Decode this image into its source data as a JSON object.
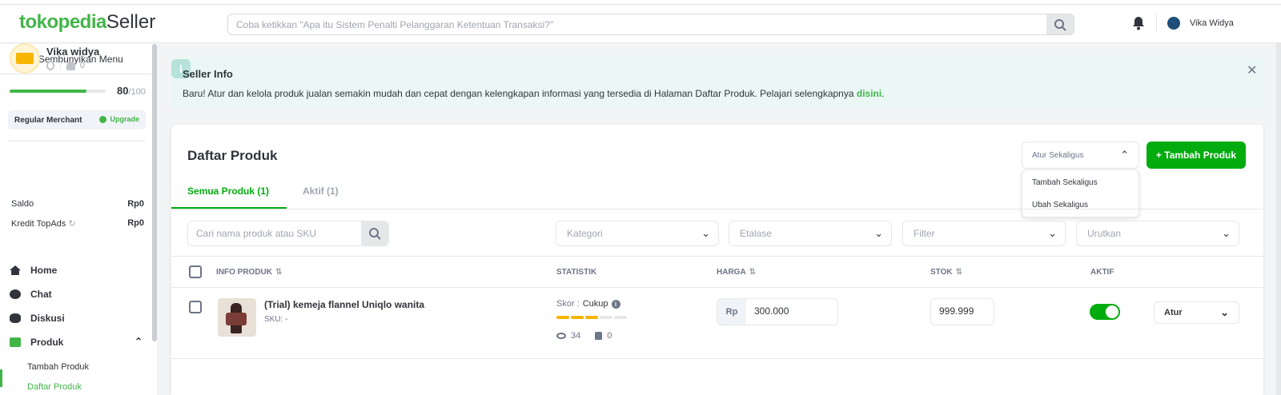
{
  "header": {
    "logo_main": "tokopedia",
    "logo_sub": "Seller",
    "search_placeholder": "Coba ketikkan \"Apa itu Sistem Penalti Pelanggaran Ketentuan Transaksi?\"",
    "user_name": "Vika Widya"
  },
  "sidebar": {
    "hide_menu": "Sembunyikan Menu",
    "shop_name": "Vika widya",
    "followers": "0",
    "score": "80",
    "score_max": "/100",
    "score_fraction": 0.8,
    "merchant_type": "Regular Merchant",
    "upgrade": "Upgrade",
    "saldo_label": "Saldo",
    "saldo_value": "Rp0",
    "kredit_label": "Kredit TopAds",
    "kredit_value": "Rp0",
    "nav": {
      "home": "Home",
      "chat": "Chat",
      "diskusi": "Diskusi",
      "produk": "Produk",
      "tambah_produk": "Tambah Produk",
      "daftar_produk": "Daftar Produk"
    }
  },
  "banner": {
    "title": "Seller Info",
    "text": "Baru! Atur dan kelola produk jualan semakin mudah dan cepat dengan kelengkapan informasi yang tersedia di Halaman Daftar Produk. Pelajari selengkapnya ",
    "link": "disini",
    "suffix": "."
  },
  "main": {
    "title": "Daftar Produk",
    "bulk_label": "Atur Sekaligus",
    "bulk_options": [
      "Tambah Sekaligus",
      "Ubah Sekaligus"
    ],
    "add_button": "+ Tambah Produk",
    "tabs": [
      "Semua Produk (1)",
      "Aktif (1)"
    ],
    "search_placeholder": "Cari nama produk atau SKU",
    "filters": [
      "Kategori",
      "Etalase",
      "Filter",
      "Urutkan"
    ],
    "columns": [
      "INFO PRODUK",
      "STATISTIK",
      "HARGA",
      "STOK",
      "AKTIF"
    ]
  },
  "product": {
    "name": "(Trial) kemeja flannel Uniqlo wanita",
    "sku": "SKU: -",
    "skor_label": "Skor :",
    "skor_value": "Cukup",
    "skor_level": 3,
    "skor_max": 5,
    "views": "34",
    "sold": "0",
    "currency": "Rp",
    "price": "300.000",
    "stock": "999.999",
    "active": true,
    "action": "Atur"
  },
  "colors": {
    "brand": "#42b549",
    "primary_button": "#03ac0e",
    "banner_bg": "#eaf7f5",
    "score_bar": "#f7b500"
  }
}
